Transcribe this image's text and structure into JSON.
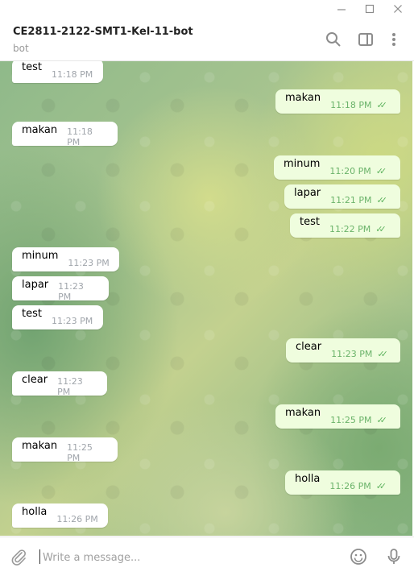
{
  "window": {
    "minimize_icon": "minimize-icon",
    "maximize_icon": "maximize-icon",
    "close_icon": "close-icon"
  },
  "header": {
    "title": "CE2811-2122-SMT1-Kel-11-bot",
    "subtitle": "bot",
    "icons": [
      "search-icon",
      "sidebar-toggle-icon",
      "more-vertical-icon"
    ]
  },
  "messages": [
    {
      "dir": "in",
      "text": "test",
      "time": "11:18 PM"
    },
    {
      "dir": "out",
      "text": "makan",
      "time": "11:18 PM"
    },
    {
      "dir": "in",
      "text": "makan",
      "time": "11:18 PM"
    },
    {
      "dir": "out",
      "text": "minum",
      "time": "11:20 PM"
    },
    {
      "dir": "out",
      "text": "lapar",
      "time": "11:21 PM"
    },
    {
      "dir": "out",
      "text": "test",
      "time": "11:22 PM"
    },
    {
      "dir": "in",
      "text": "minum",
      "time": "11:23 PM"
    },
    {
      "dir": "in",
      "text": "lapar",
      "time": "11:23 PM"
    },
    {
      "dir": "in",
      "text": "test",
      "time": "11:23 PM"
    },
    {
      "dir": "out",
      "text": "clear",
      "time": "11:23 PM"
    },
    {
      "dir": "in",
      "text": "clear",
      "time": "11:23 PM"
    },
    {
      "dir": "out",
      "text": "makan",
      "time": "11:25 PM"
    },
    {
      "dir": "in",
      "text": "makan",
      "time": "11:25 PM"
    },
    {
      "dir": "out",
      "text": "holla",
      "time": "11:26 PM"
    },
    {
      "dir": "in",
      "text": "holla",
      "time": "11:26 PM"
    }
  ],
  "composer": {
    "placeholder": "Write a message...",
    "icons": [
      "attach-icon",
      "emoji-icon",
      "microphone-icon"
    ]
  }
}
